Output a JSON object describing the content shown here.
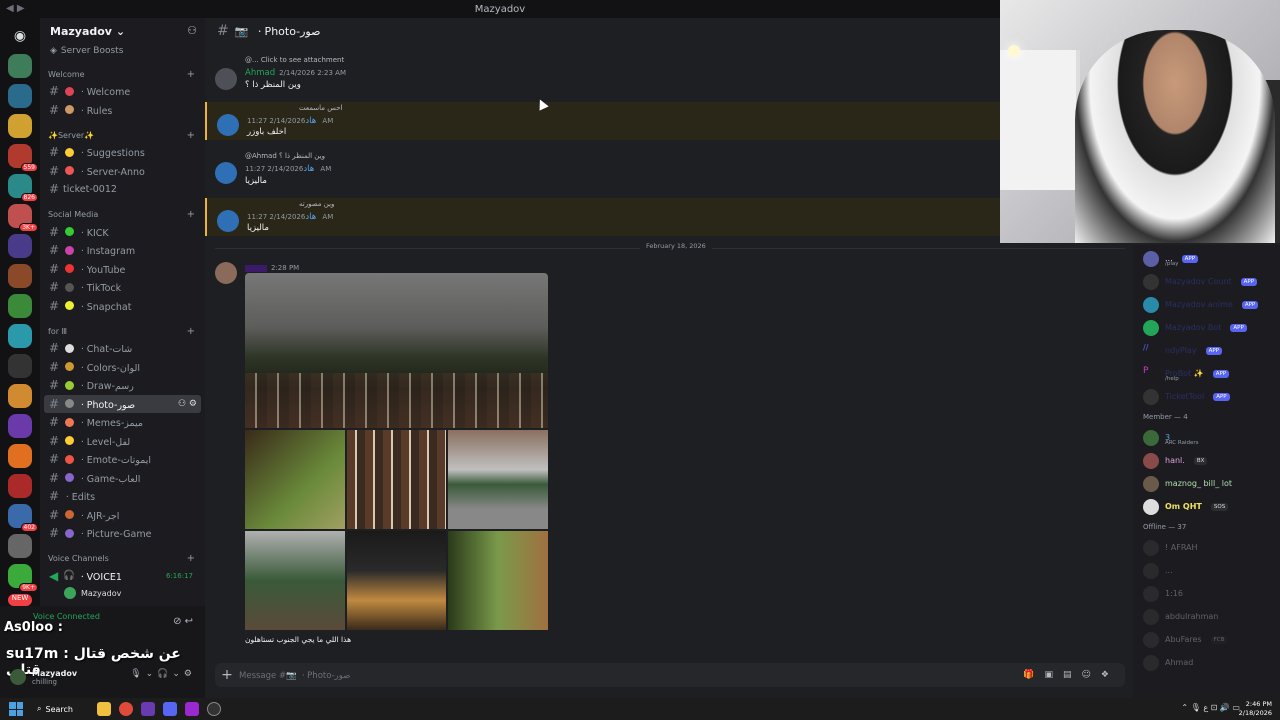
{
  "window": {
    "title": "Mazyadov"
  },
  "guild": {
    "name": "Mazyadov",
    "boosts_label": "Server Boosts"
  },
  "categories": {
    "welcome": "Welcome",
    "server": "✨Server✨",
    "social": "Social Media",
    "for": "for Ⅲ",
    "voice": "Voice Channels"
  },
  "channels": {
    "welcome": [
      "ㆍWelcome",
      "ㆍRules"
    ],
    "server": [
      "ㆍSuggestions",
      "ㆍServer-Anno",
      "ticket-0012"
    ],
    "social": [
      "ㆍKICK",
      "ㆍInstagram",
      "ㆍYouTube",
      "ㆍTikTock",
      "ㆍSnapchat"
    ],
    "for": [
      "ㆍChat-شات",
      "ㆍColors-الوان",
      "ㆍDraw-رسم",
      "ㆍPhoto-صور",
      "ㆍMemes-ميمز",
      "ㆍLevel-لفل",
      "ㆍEmote-ايموتات",
      "ㆍGame-العاب",
      "ㆍEdits",
      "ㆍAJR-اجر",
      "ㆍPicture-Game"
    ],
    "voice": [
      "ㆍVOICE1"
    ]
  },
  "voice": {
    "elapsed": "6:16:17",
    "member": "Mazyadov",
    "connected_label": "Voice Connected",
    "overlay_name": "As0loo :",
    "overlay_text": "su17m : عن شخص قتال قتلى"
  },
  "self_user": {
    "name": "Mazyadov",
    "status": "chilling"
  },
  "active_channel": {
    "title": "ㆍPhoto-صور",
    "composer_placeholder": "Message #📷 ㆍPhoto-صور"
  },
  "messages": [
    {
      "reply": "@... Click to see attachment",
      "author": "Ahmad",
      "time": "2/14/2026 2:23 AM",
      "body": "وين المنظر ذا ؟"
    },
    {
      "reply": "احس ماسمعت",
      "author": "هاد",
      "time": "2/14/2026 11:27 AM",
      "body": "اخلف باوزر"
    },
    {
      "reply": "@Ahmad وين المنظر ذا ؟",
      "author": "هاد",
      "time": "2/14/2026 11:27 AM",
      "body": "ماليزيا"
    },
    {
      "reply": "وين مصورته",
      "author": "هاد",
      "time": "2/14/2026 11:27 AM",
      "body": "ماليزيا"
    }
  ],
  "date_divider": "February 18, 2026",
  "photo_post": {
    "time": "2:28 PM",
    "caption": "هذا اللي ما يجي الجنوب تستاهلون"
  },
  "members": {
    "apps": [
      {
        "name": "...",
        "sub": "/play",
        "badge": "APP"
      },
      {
        "name": "Mazyadov Count",
        "badge": "APP"
      },
      {
        "name": "Mazyadov anime",
        "badge": "APP"
      },
      {
        "name": "Mazyadov Bot",
        "badge": "APP"
      },
      {
        "name": "ndyPlay",
        "badge": "APP"
      },
      {
        "name": "ProBot ✨",
        "sub": "/help",
        "badge": "APP"
      },
      {
        "name": "TicketTool",
        "badge": "APP"
      }
    ],
    "member_header": "Member — 4",
    "online": [
      {
        "name": "3",
        "sub": "ARC Raiders"
      },
      {
        "name": "hanl.",
        "tag": "BX"
      },
      {
        "name": "maznog_ bill_ lot"
      },
      {
        "name": "Om QHT",
        "tag": "SOS"
      }
    ],
    "offline_header": "Offline — 37",
    "offline": [
      {
        "name": "! AFRAH"
      },
      {
        "name": "..."
      },
      {
        "name": "1:16"
      },
      {
        "name": "abdulrahman"
      },
      {
        "name": "AbuFares",
        "tag": "FCB"
      },
      {
        "name": "Ahmad"
      }
    ]
  },
  "taskbar": {
    "search_label": "Search",
    "time": "2:46 PM",
    "date": "2/18/2026"
  },
  "colors": {
    "accent": "#5865f2",
    "online": "#23a55a",
    "highlight": "#f0b232"
  }
}
